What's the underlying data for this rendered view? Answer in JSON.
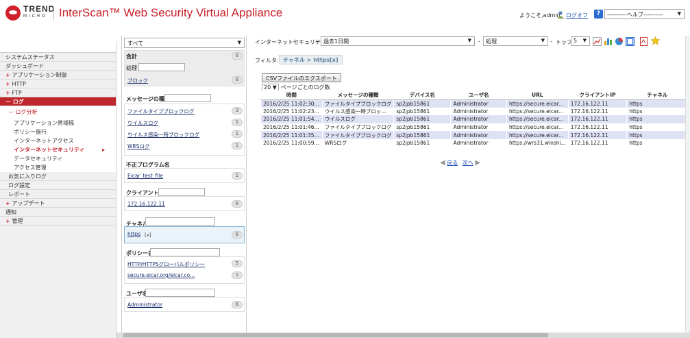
{
  "header": {
    "logo_text": "TREND",
    "logo_sub": "MICRO",
    "app_title": "InterScan™ Web Security Virtual Appliance",
    "welcome": "ようこそ,admin",
    "logout": "ログオフ",
    "help_select": "----------ヘルプ----------"
  },
  "nav": {
    "items": [
      {
        "label": "システムステータス",
        "kind": "plain"
      },
      {
        "label": "ダッシュボード",
        "kind": "plain"
      },
      {
        "label": "アプリケーション制御",
        "kind": "plus"
      },
      {
        "label": "HTTP",
        "kind": "plus"
      },
      {
        "label": "FTP",
        "kind": "plus"
      },
      {
        "label": "ログ",
        "kind": "active"
      },
      {
        "label": "ログ分析",
        "kind": "sub"
      },
      {
        "label": "アプリケーション帯域幅",
        "kind": "sub2"
      },
      {
        "label": "ポリシー施行",
        "kind": "sub2"
      },
      {
        "label": "インターネットアクセス",
        "kind": "sub2"
      },
      {
        "label": "インターネットセキュリティ",
        "kind": "current"
      },
      {
        "label": "データセキュリティ",
        "kind": "sub2"
      },
      {
        "label": "アクセス管理",
        "kind": "sub2"
      },
      {
        "label": "お気に入りログ",
        "kind": "lvl"
      },
      {
        "label": "ログ設定",
        "kind": "lvl"
      },
      {
        "label": "レポート",
        "kind": "lvl"
      },
      {
        "label": "アップデート",
        "kind": "plus"
      },
      {
        "label": "通知",
        "kind": "plain"
      },
      {
        "label": "管理",
        "kind": "plus"
      }
    ]
  },
  "facets": {
    "scope": "すべて",
    "total_label": "合計",
    "total_count": "6",
    "action_label": "処理",
    "action_item": "ブロック",
    "action_count": "6",
    "msgtype_label": "メッセージの種類",
    "msgtypes": [
      {
        "label": "ファイルタイプブロックログ",
        "count": "3"
      },
      {
        "label": "ウイルスログ",
        "count": "1"
      },
      {
        "label": "ウイルス感染一時ブロックログ",
        "count": "1"
      },
      {
        "label": "WRSログ",
        "count": "1"
      }
    ],
    "malware_label": "不正プログラム名",
    "malware_item": "Eicar_test_file",
    "malware_count": "1",
    "client_label": "クライアントIP",
    "client_item": "172.16.122.11",
    "client_count": "6",
    "channel_label": "チャネル",
    "channel_item": "https",
    "channel_x": "[x]",
    "channel_count": "6",
    "policy_label": "ポリシー名",
    "policies": [
      {
        "label": "HTTP/HTTPSグローバルポリシー",
        "count": "5"
      },
      {
        "label": "secure.eicar.org/eicar.co...",
        "count": "1"
      }
    ],
    "user_label": "ユーザ名",
    "user_item": "Administrator",
    "user_count": "6"
  },
  "toolbar": {
    "category": "インターネットセキュリティ",
    "period": "過去1日間",
    "action": "処理",
    "top_label": "トップ",
    "top_value": "5",
    "filter_label": "フィルタ:",
    "filter_value": "チャネル > https[x]",
    "csv_button": "CSVファイルのエクスポート",
    "per_page_value": "20",
    "per_page_label": "ページごとのログ数"
  },
  "table": {
    "columns": [
      "時間",
      "メッセージの種類",
      "デバイス名",
      "ユーザ名",
      "URL",
      "クライアントIP",
      "チャネル"
    ],
    "rows": [
      [
        "2016/2/25 11:02:30...",
        "ファイルタイプブロックログ",
        "sp2jpb15861",
        "Administrator",
        "https://secure.eicar...",
        "172.16.122.11",
        "https"
      ],
      [
        "2016/2/25 11:02:23...",
        "ウイルス感染一時ブロッ...",
        "sp2jpb15861",
        "Administrator",
        "https://secure.eicar...",
        "172.16.122.11",
        "https"
      ],
      [
        "2016/2/25 11:01:54...",
        "ウイルスログ",
        "sp2jpb15861",
        "Administrator",
        "https://secure.eicar...",
        "172.16.122.11",
        "https"
      ],
      [
        "2016/2/25 11:01:46...",
        "ファイルタイプブロックログ",
        "sp2jpb15861",
        "Administrator",
        "https://secure.eicar...",
        "172.16.122.11",
        "https"
      ],
      [
        "2016/2/25 11:01:35...",
        "ファイルタイプブロックログ",
        "sp2jpb15861",
        "Administrator",
        "https://secure.eicar...",
        "172.16.122.11",
        "https"
      ],
      [
        "2016/2/25 11:00:59...",
        "WRSログ",
        "sp2jpb15861",
        "Administrator",
        "https://wrs31.winshi...",
        "172.16.122.11",
        "https"
      ]
    ],
    "pager_prev": "戻る",
    "pager_next": "次へ"
  },
  "colors": {
    "brand_red": "#c8202a",
    "nav_active": "#c0262d",
    "row_stripe": "#dfe1f4",
    "link": "#1a4db3"
  }
}
